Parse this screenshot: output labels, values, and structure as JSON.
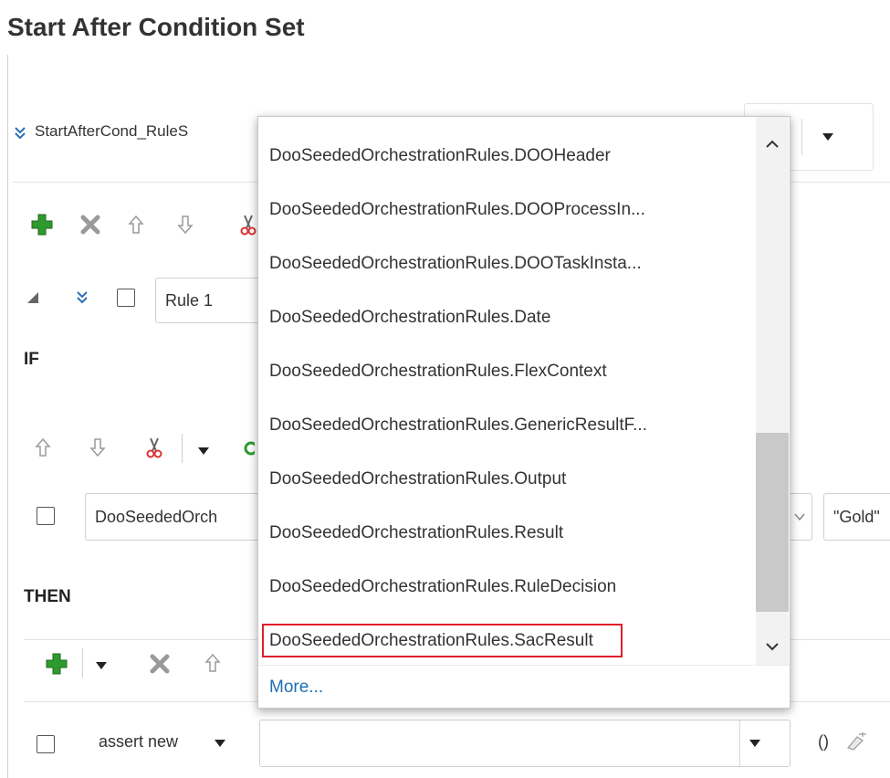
{
  "page": {
    "title": "Start After Condition Set"
  },
  "ruleset": {
    "name": "StartAfterCond_RuleS"
  },
  "rule": {
    "name": "Rule 1"
  },
  "sections": {
    "if_label": "IF",
    "then_label": "THEN"
  },
  "condition": {
    "left_value": "DooSeededOrch",
    "right_value": "\"Gold\""
  },
  "action": {
    "verb": "assert new",
    "params_label": "()"
  },
  "dropdown": {
    "items": [
      "DooSeededOrchestrationRules.DOOHeader",
      "DooSeededOrchestrationRules.DOOProcessIn...",
      "DooSeededOrchestrationRules.DOOTaskInsta...",
      "DooSeededOrchestrationRules.Date",
      "DooSeededOrchestrationRules.FlexContext",
      "DooSeededOrchestrationRules.GenericResultF...",
      "DooSeededOrchestrationRules.Output",
      "DooSeededOrchestrationRules.Result",
      "DooSeededOrchestrationRules.RuleDecision",
      "DooSeededOrchestrationRules.SacResult"
    ],
    "highlighted_item": "DooSeededOrchestrationRules.SacResult",
    "more_label": "More..."
  },
  "colors": {
    "add_green": "#2e9a2e",
    "highlight_red": "#e0202a",
    "link_blue": "#1f6fb5"
  }
}
